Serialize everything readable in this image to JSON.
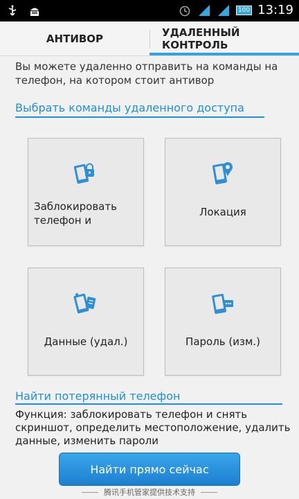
{
  "statusbar": {
    "time": "13:19",
    "battery": "100",
    "left_icons": [
      "usb-icon",
      "android-debug-icon"
    ],
    "right_icons": [
      "alarm-icon",
      "signal-icon",
      "signal-icon-2",
      "battery-icon"
    ]
  },
  "tabs": [
    {
      "label": "АНТИВОР",
      "active": false
    },
    {
      "label_line1": "УДАЛЕННЫЙ",
      "label_line2": "КОНТРОЛЬ",
      "active": true
    }
  ],
  "intro": "Вы можете удаленно отправить на команды на телефон, на котором стоит антивор",
  "section_commands": "Выбрать команды удаленного доступа",
  "cards": [
    {
      "label": "Заблокировать телефон и",
      "icon": "phone-lock-icon"
    },
    {
      "label": "Локация",
      "icon": "phone-location-icon"
    },
    {
      "label": "Данные (удал.)",
      "icon": "phone-data-icon"
    },
    {
      "label": "Пароль (изм.)",
      "icon": "phone-password-icon"
    }
  ],
  "section_find": "Найти потерянный телефон",
  "description": "Функция: заблокировать телефон и снять скриншот, определить местоположение, удалить данные, изменить пароли",
  "find_button": "Найти прямо сейчас",
  "footer": "腾讯手机管家提供技术支持",
  "colors": {
    "accent": "#1e90d8",
    "button": "#2b93e0",
    "statusbar": "#000000"
  }
}
